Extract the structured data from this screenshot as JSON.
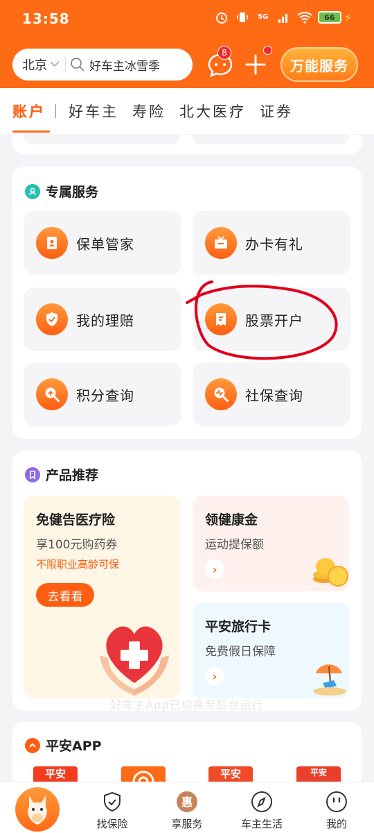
{
  "status_bar": {
    "time": "13:58",
    "battery": "66",
    "network": "5G"
  },
  "header": {
    "city": "北京",
    "search_placeholder": "好车主冰雪季",
    "message_badge": "8",
    "super_service": "万能服务"
  },
  "tabs": [
    {
      "label": "账户",
      "active": true
    },
    {
      "label": "好车主"
    },
    {
      "label": "寿险"
    },
    {
      "label": "北大医疗"
    },
    {
      "label": "证券"
    }
  ],
  "exclusive_services": {
    "title": "专属服务",
    "items": [
      {
        "label": "保单管家",
        "icon": "policy-icon"
      },
      {
        "label": "办卡有礼",
        "icon": "tv-gift-icon"
      },
      {
        "label": "我的理赔",
        "icon": "shield-check-icon"
      },
      {
        "label": "股票开户",
        "icon": "receipt-icon"
      },
      {
        "label": "积分查询",
        "icon": "points-search-icon"
      },
      {
        "label": "社保查询",
        "icon": "social-security-icon"
      }
    ]
  },
  "products": {
    "title": "产品推荐",
    "featured": {
      "title": "免健告医疗险",
      "subtitle": "享100元购药券",
      "tag": "不限职业高龄可保",
      "cta": "去看看"
    },
    "side": [
      {
        "title": "领健康金",
        "subtitle": "运动提保额"
      },
      {
        "title": "平安旅行卡",
        "subtitle": "免费假日保障"
      }
    ]
  },
  "toast": "好车主App已切换至后台运行",
  "pingan_apps": {
    "title": "平安APP",
    "logos": [
      "平安",
      "",
      "平安",
      "平安"
    ]
  },
  "bottom_nav": [
    {
      "label": "找保险",
      "icon": "shield-icon"
    },
    {
      "label": "享服务",
      "icon": "hui-icon"
    },
    {
      "label": "车主生活",
      "icon": "compass-icon"
    },
    {
      "label": "我的",
      "icon": "smiley-icon"
    }
  ],
  "colors": {
    "brand": "#ff6a14",
    "annotation": "#e0001a"
  }
}
